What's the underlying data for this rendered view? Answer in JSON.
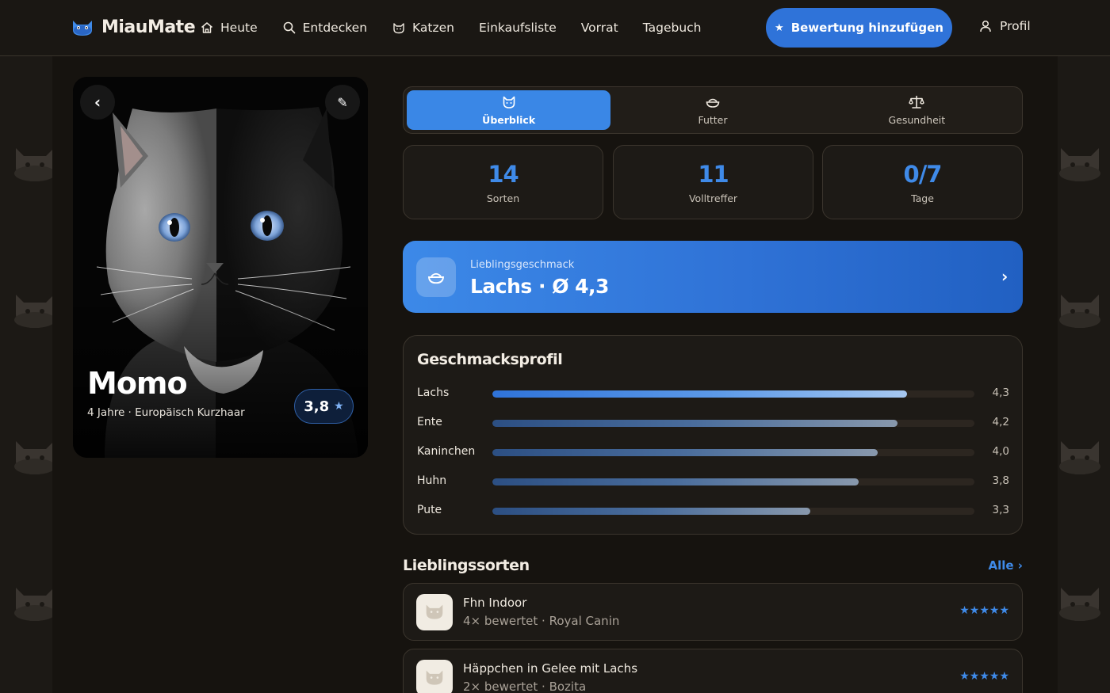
{
  "app": {
    "name": "MiauMate"
  },
  "nav": {
    "items": [
      {
        "label": "Heute",
        "icon": "home-icon"
      },
      {
        "label": "Entdecken",
        "icon": "search-icon"
      },
      {
        "label": "Katzen",
        "icon": "cat-icon"
      },
      {
        "label": "Einkaufsliste"
      },
      {
        "label": "Vorrat"
      },
      {
        "label": "Tagebuch"
      }
    ],
    "cta_label": "Bewertung hinzufügen",
    "profile_label": "Profil"
  },
  "cat": {
    "name": "Momo",
    "meta": "4 Jahre · Europäisch Kurzhaar",
    "rating": "3,8"
  },
  "tabs": [
    {
      "label": "Überblick",
      "icon": "cat-icon",
      "active": true
    },
    {
      "label": "Futter",
      "icon": "bowl-icon",
      "active": false
    },
    {
      "label": "Gesundheit",
      "icon": "scale-icon",
      "active": false
    }
  ],
  "stats": [
    {
      "value": "14",
      "label": "Sorten"
    },
    {
      "value": "11",
      "label": "Volltreffer"
    },
    {
      "value": "0/7",
      "label": "Tage"
    }
  ],
  "favorite_taste": {
    "label": "Lieblingsgeschmack",
    "value": "Lachs · Ø 4,3"
  },
  "taste_profile": {
    "title": "Geschmacksprofil",
    "scale_max": 5,
    "rows": [
      {
        "name": "Lachs",
        "score": 4.3,
        "label": "4,3"
      },
      {
        "name": "Ente",
        "score": 4.2,
        "label": "4,2"
      },
      {
        "name": "Kaninchen",
        "score": 4.0,
        "label": "4,0"
      },
      {
        "name": "Huhn",
        "score": 3.8,
        "label": "3,8"
      },
      {
        "name": "Pute",
        "score": 3.3,
        "label": "3,3"
      }
    ]
  },
  "favorites": {
    "title": "Lieblingssorten",
    "all_label": "Alle ›",
    "items": [
      {
        "title": "Fhn Indoor",
        "subtitle": "4× bewertet · Royal Canin",
        "stars": 5
      },
      {
        "title": "Häppchen in Gelee mit Lachs",
        "subtitle": "2× bewertet · Bozita",
        "stars": 5
      }
    ]
  },
  "colors": {
    "accent": "#3a87e6",
    "accent_dark": "#2160c2",
    "background": "#16130f",
    "card": "#1d1a16"
  }
}
